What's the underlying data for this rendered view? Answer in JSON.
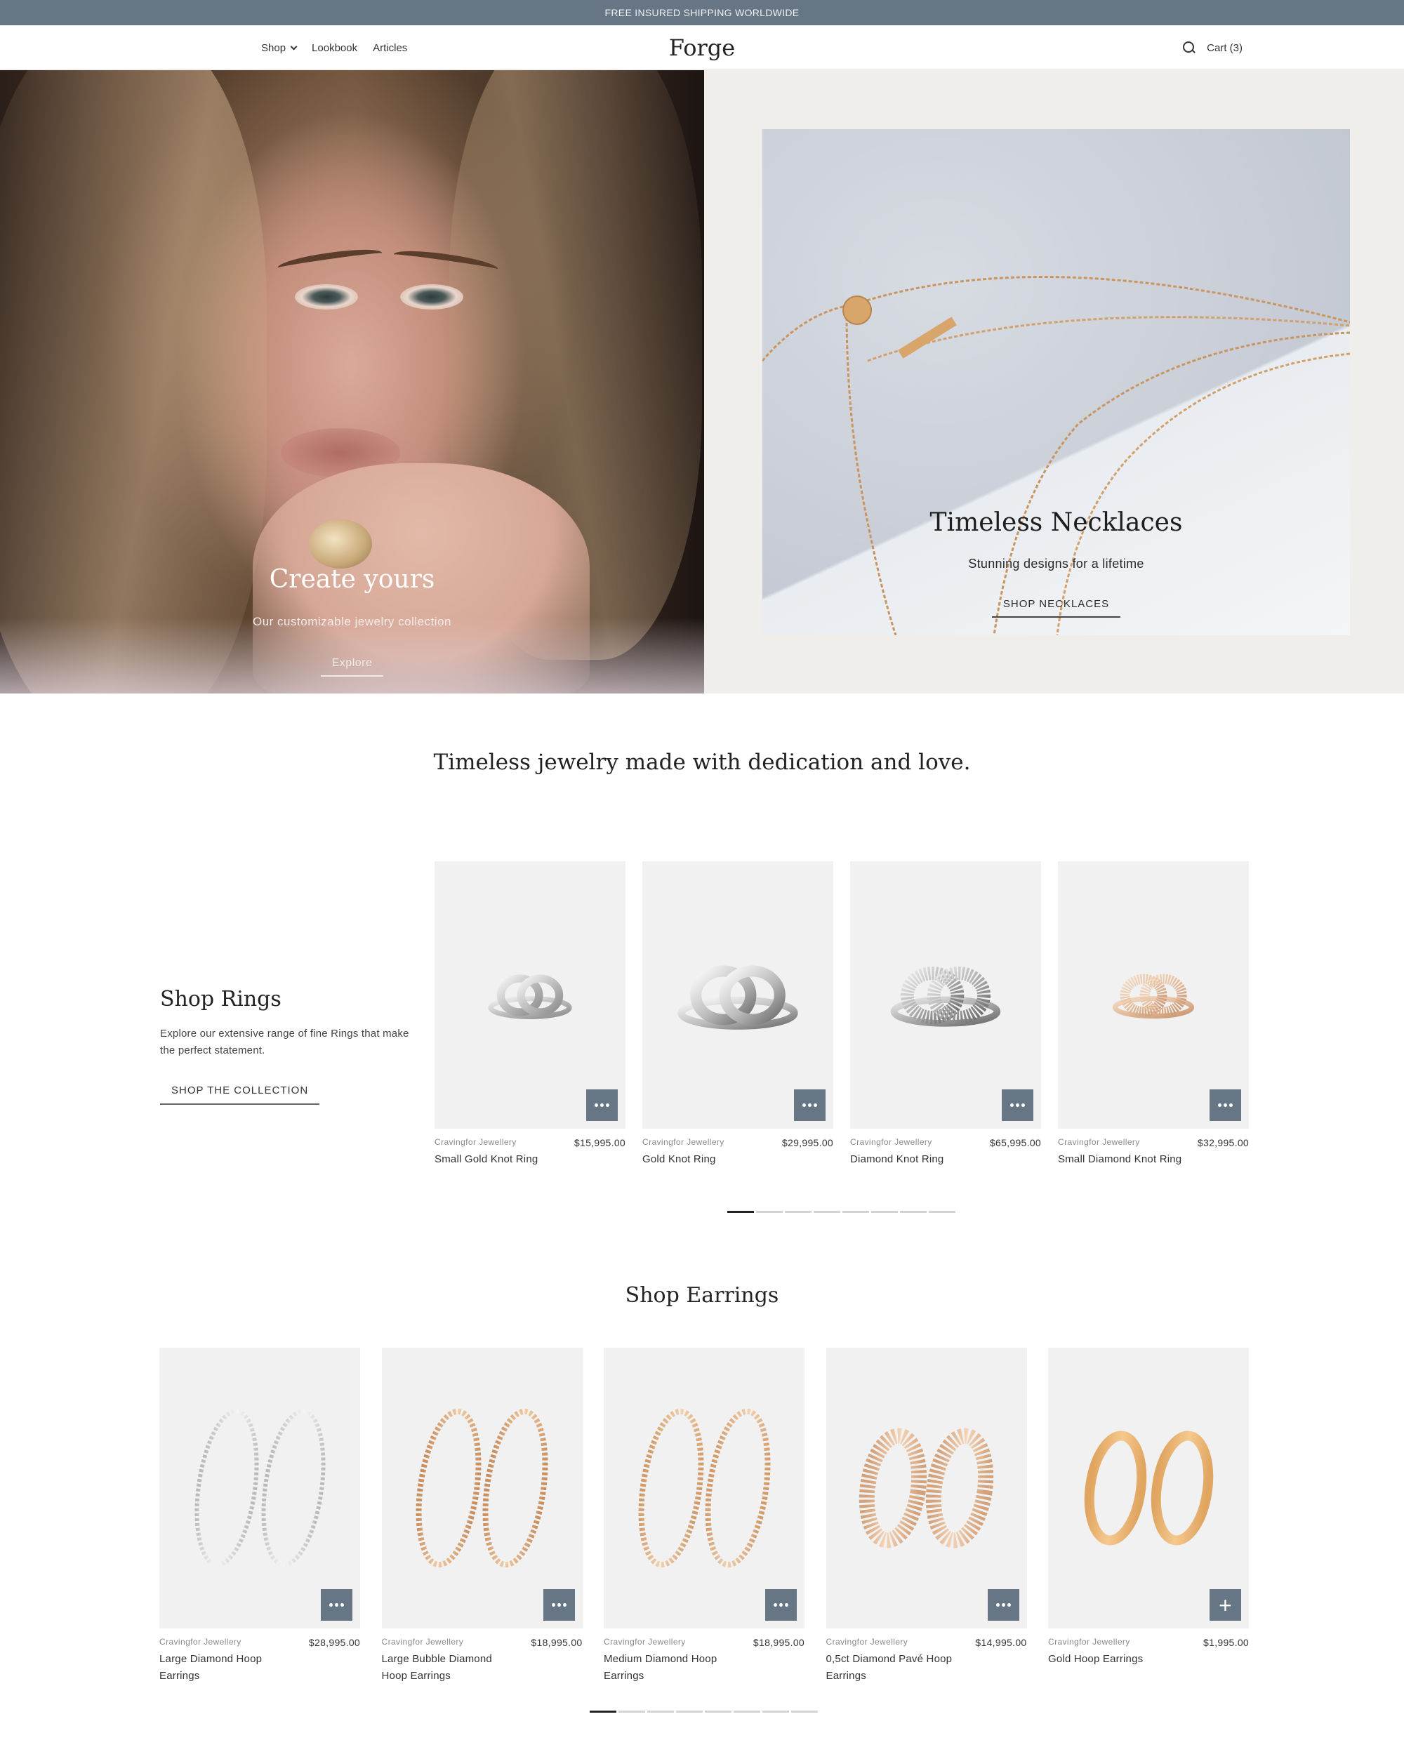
{
  "announcement": "FREE INSURED SHIPPING WORLDWIDE",
  "header": {
    "nav": [
      {
        "label": "Shop",
        "has_dropdown": true
      },
      {
        "label": "Lookbook"
      },
      {
        "label": "Articles"
      }
    ],
    "logo": "Forge",
    "cart_label": "Cart (3)",
    "search_icon": "search-icon"
  },
  "hero": {
    "left": {
      "title": "Create yours",
      "subtitle": "Our customizable jewelry collection",
      "link": "Explore"
    },
    "right": {
      "title": "Timeless Necklaces",
      "subtitle": "Stunning designs for a lifetime",
      "link": "SHOP NECKLACES"
    }
  },
  "tagline": "Timeless jewelry made with dedication and love.",
  "rings": {
    "heading": "Shop Rings",
    "description": "Explore our extensive range of fine Rings that make the perfect statement.",
    "cta": "SHOP THE COLLECTION",
    "products": [
      {
        "vendor": "Cravingfor Jewellery",
        "title": "Small Gold Knot Ring",
        "price": "$15,995.00",
        "action": "more-icon"
      },
      {
        "vendor": "Cravingfor Jewellery",
        "title": "Gold Knot Ring",
        "price": "$29,995.00",
        "action": "more-icon"
      },
      {
        "vendor": "Cravingfor Jewellery",
        "title": "Diamond Knot Ring",
        "price": "$65,995.00",
        "action": "more-icon"
      },
      {
        "vendor": "Cravingfor Jewellery",
        "title": "Small Diamond Knot Ring",
        "price": "$32,995.00",
        "action": "more-icon"
      }
    ],
    "pager": {
      "pages": 8,
      "current": 1
    }
  },
  "earrings": {
    "heading": "Shop Earrings",
    "products": [
      {
        "vendor": "Cravingfor Jewellery",
        "title": "Large Diamond Hoop Earrings",
        "price": "$28,995.00",
        "action": "more-icon"
      },
      {
        "vendor": "Cravingfor Jewellery",
        "title": "Large Bubble Diamond Hoop Earrings",
        "price": "$18,995.00",
        "action": "more-icon"
      },
      {
        "vendor": "Cravingfor Jewellery",
        "title": "Medium Diamond Hoop Earrings",
        "price": "$18,995.00",
        "action": "more-icon"
      },
      {
        "vendor": "Cravingfor Jewellery",
        "title": "0,5ct Diamond Pavé Hoop Earrings",
        "price": "$14,995.00",
        "action": "more-icon"
      },
      {
        "vendor": "Cravingfor Jewellery",
        "title": "Gold Hoop Earrings",
        "price": "$1,995.00",
        "action": "plus-icon"
      }
    ],
    "pager": {
      "pages": 8,
      "current": 1
    }
  },
  "colors": {
    "accent": "#677685",
    "hero_right_bg": "#efeeea",
    "card_bg": "#f1f1f1",
    "text": "#222222"
  }
}
